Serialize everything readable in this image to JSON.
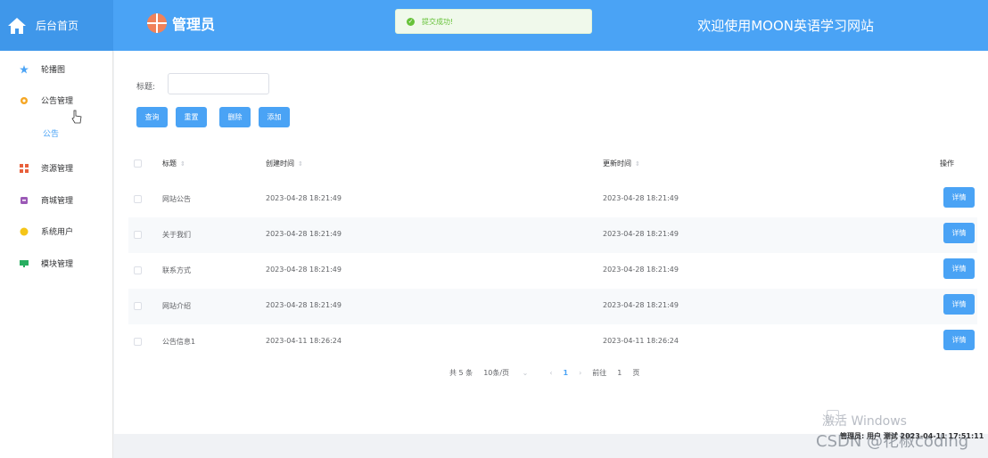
{
  "header": {
    "home_label": "后台首页",
    "admin_label": "管理员",
    "welcome": "欢迎使用MOON英语学习网站",
    "toast": "提交成功!"
  },
  "sidebar": {
    "items": [
      {
        "label": "轮播图"
      },
      {
        "label": "公告管理"
      },
      {
        "label": "资源管理"
      },
      {
        "label": "商城管理"
      },
      {
        "label": "系统用户"
      },
      {
        "label": "模块管理"
      }
    ],
    "sub_item": "公告"
  },
  "search": {
    "title_label": "标题:",
    "title_value": "",
    "buttons": {
      "query": "查询",
      "reset": "重置",
      "delete": "删除",
      "add": "添加"
    }
  },
  "table": {
    "columns": [
      "标题",
      "创建时间",
      "更新时间",
      "操作"
    ],
    "rows": [
      {
        "title": "网站公告",
        "created": "2023-04-28 18:21:49",
        "updated": "2023-04-28 18:21:49",
        "action": "详情"
      },
      {
        "title": "关于我们",
        "created": "2023-04-28 18:21:49",
        "updated": "2023-04-28 18:21:49",
        "action": "详情"
      },
      {
        "title": "联系方式",
        "created": "2023-04-28 18:21:49",
        "updated": "2023-04-28 18:21:49",
        "action": "详情"
      },
      {
        "title": "网站介绍",
        "created": "2023-04-28 18:21:49",
        "updated": "2023-04-28 18:21:49",
        "action": "详情"
      },
      {
        "title": "公告信息1",
        "created": "2023-04-11 18:26:24",
        "updated": "2023-04-11 18:26:24",
        "action": "详情"
      }
    ]
  },
  "pagination": {
    "total": "共 5 条",
    "page_size": "10条/页",
    "current_page": "1",
    "goto_label": "前往",
    "goto_value": "1",
    "page_suffix": "页"
  },
  "watermark": {
    "activate": "激活 Windows",
    "csdn": "CSDN @花椒coding",
    "overlay": "管理员: 用户 测试 2023-04-11 17:51:11"
  },
  "colors": {
    "accent": "#4aa3f5",
    "success": "#67c23a"
  }
}
